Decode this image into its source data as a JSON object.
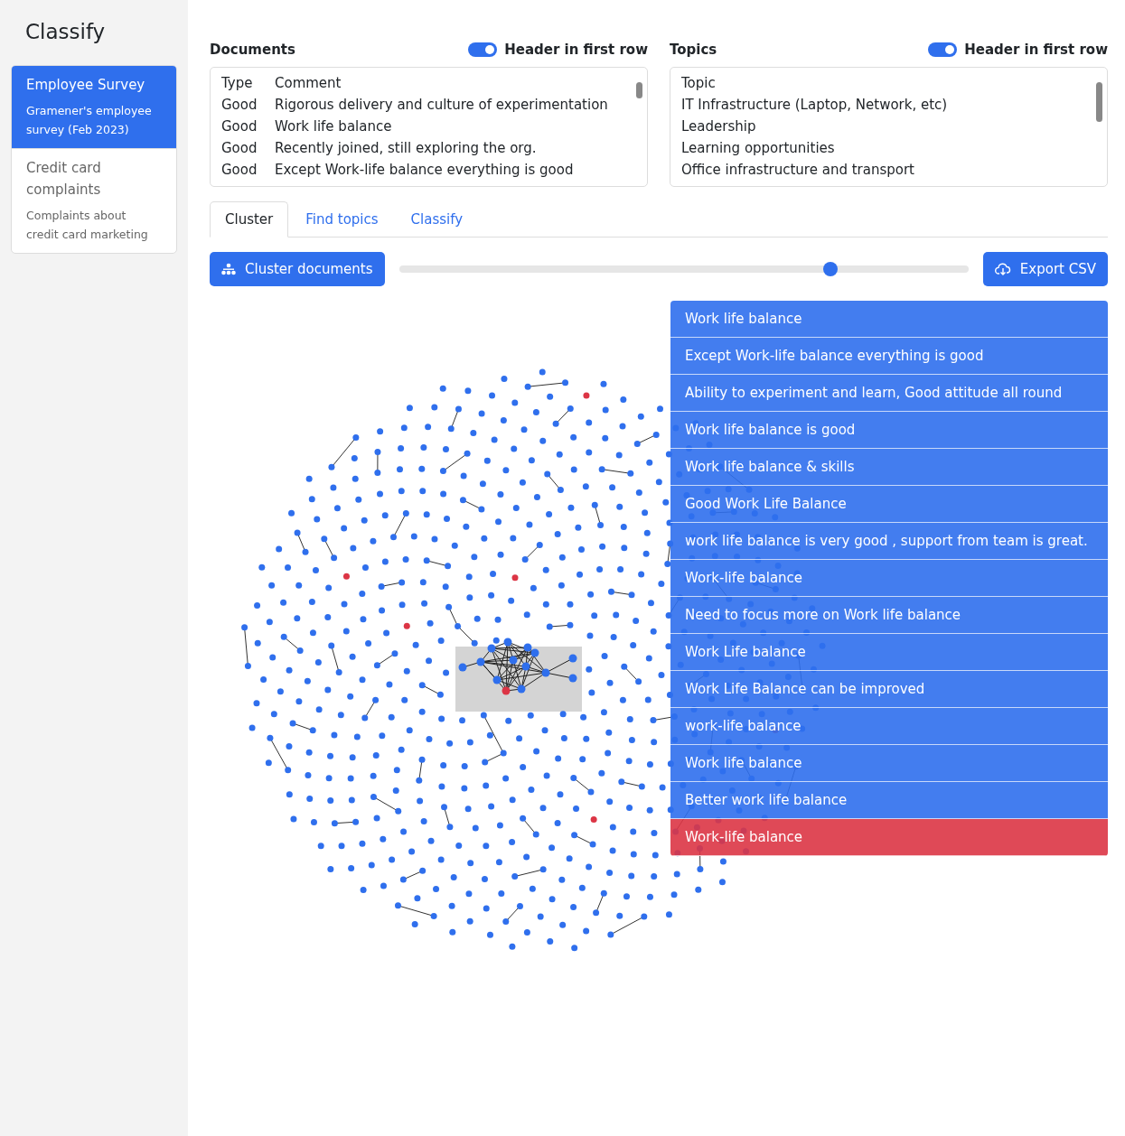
{
  "app": {
    "title": "Classify"
  },
  "datasets": [
    {
      "name": "Employee Survey",
      "description": "Gramener's employee survey (Feb 2023)",
      "selected": true
    },
    {
      "name": "Credit card complaints",
      "description": "Complaints about credit card marketing",
      "selected": false
    }
  ],
  "documents": {
    "title": "Documents",
    "toggle_label": "Header in first row",
    "header_in_first_row": true,
    "rows": [
      [
        "Type",
        "Comment"
      ],
      [
        "Good",
        "Rigorous delivery and culture of experimentation"
      ],
      [
        "Good",
        "Work life balance"
      ],
      [
        "Good",
        "Recently joined, still exploring the org."
      ],
      [
        "Good",
        "Except Work-life balance everything is good"
      ]
    ]
  },
  "topics": {
    "title": "Topics",
    "toggle_label": "Header in first row",
    "header_in_first_row": true,
    "rows": [
      "Topic",
      "IT Infrastructure (Laptop, Network, etc)",
      "Leadership",
      "Learning opportunities",
      "Office infrastructure and transport"
    ]
  },
  "tabs": [
    {
      "label": "Cluster",
      "selected": true
    },
    {
      "label": "Find topics",
      "selected": false
    },
    {
      "label": "Classify",
      "selected": false
    }
  ],
  "cluster_button": "Cluster documents",
  "threshold_slider": {
    "level": 0.757
  },
  "export_button": "Export CSV",
  "cluster_items": [
    {
      "text": "Work life balance",
      "selected": false
    },
    {
      "text": "Except Work-life balance everything is good",
      "selected": false
    },
    {
      "text": "Ability to experiment and learn, Good attitude all round",
      "selected": false
    },
    {
      "text": "Work life balance is good",
      "selected": false
    },
    {
      "text": "Work life balance & skills",
      "selected": false
    },
    {
      "text": "Good Work Life Balance",
      "selected": false
    },
    {
      "text": "work life balance is very good , support from team is great.",
      "selected": false
    },
    {
      "text": "Work-life balance",
      "selected": false
    },
    {
      "text": "Need to focus more on Work life balance",
      "selected": false
    },
    {
      "text": "Work Life balance",
      "selected": false
    },
    {
      "text": "Work Life Balance can be improved",
      "selected": false
    },
    {
      "text": "work-life balance",
      "selected": false
    },
    {
      "text": "Work life balance",
      "selected": false
    },
    {
      "text": "Better work life balance",
      "selected": false
    },
    {
      "text": "Work-life balance",
      "selected": true
    }
  ]
}
